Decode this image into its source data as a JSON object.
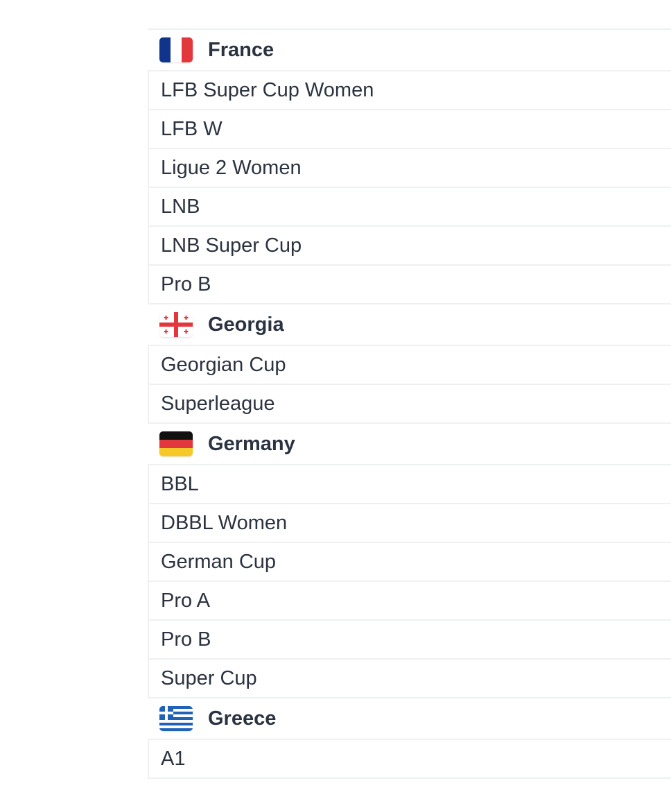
{
  "groups": [
    {
      "country": "France",
      "flag_icon": "france-flag-icon",
      "leagues": [
        "LFB Super Cup Women",
        "LFB W",
        "Ligue 2 Women",
        "LNB",
        "LNB Super Cup",
        "Pro B"
      ]
    },
    {
      "country": "Georgia",
      "flag_icon": "georgia-flag-icon",
      "leagues": [
        "Georgian Cup",
        "Superleague"
      ]
    },
    {
      "country": "Germany",
      "flag_icon": "germany-flag-icon",
      "leagues": [
        "BBL",
        "DBBL Women",
        "German Cup",
        "Pro A",
        "Pro B",
        "Super Cup"
      ]
    },
    {
      "country": "Greece",
      "flag_icon": "greece-flag-icon",
      "leagues": [
        "A1"
      ]
    }
  ],
  "colors": {
    "text": "#2b3340",
    "divider": "#eef0f2"
  }
}
